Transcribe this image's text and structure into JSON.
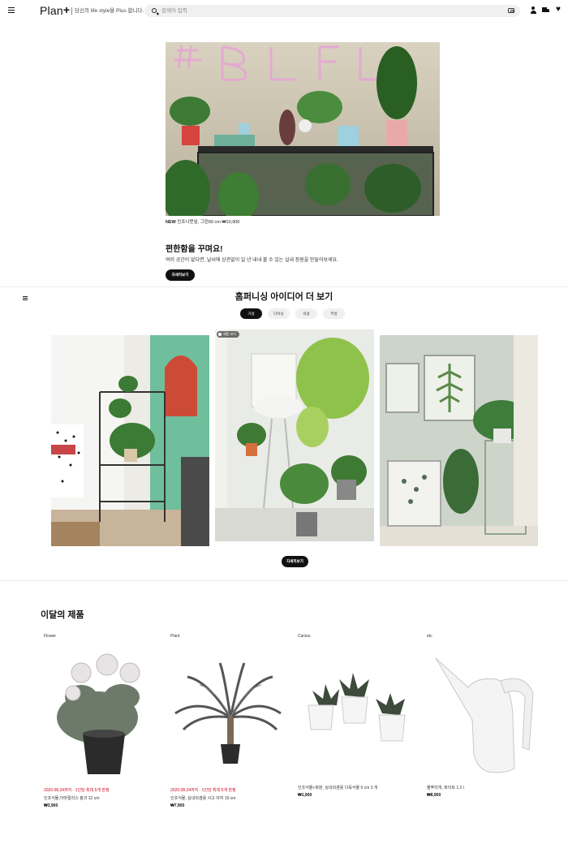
{
  "header": {
    "logo": "Plan",
    "logo_plus": "+",
    "tagline": "당신의 life style을 Plus 합니다.",
    "search_placeholder": "검색어 입력"
  },
  "hero": {
    "caption_new": "NEW",
    "caption_text": " 인조나뭇잎, 그린60 cm ₩10,900",
    "title": "편한함을 꾸며요!",
    "description": "여러 공간이 없다면, 날씨에 상관없이 일 년 내내 볼 수 있는 실내 정원을 만들어보세요.",
    "button": "자세히보기"
  },
  "ideas": {
    "title": "홈퍼니싱 아이디어 더 보기",
    "tabs": [
      "거실",
      "다이닝",
      "욕실",
      "주방"
    ],
    "badge": "제품 보기",
    "button": "자세히보기"
  },
  "products": {
    "title": "이달의 제품",
    "items": [
      {
        "category": "Flower",
        "promo": "2020.08.24까지 · 1인당 최대 5개 한정",
        "name": "인조식물,아마릴리스 핑크 12 cm",
        "price": "₩3,900"
      },
      {
        "category": "Plant",
        "promo": "2020.08.24까지 · 1인당 최대 5개 한정",
        "name": "인조식물, 실내외겸용 사고 야자 19 cm",
        "price": "₩7,900"
      },
      {
        "category": "Cactus",
        "promo": "",
        "name": "인조식물+화분, 실내외겸용 다육식물 6 cm 3 개",
        "price": "₩1,900"
      },
      {
        "category": "etc",
        "promo": "",
        "name": "물뿌리개, 화이트 1.2 l",
        "price": "₩8,900"
      }
    ]
  },
  "colors": {
    "accent_black": "#111111",
    "promo_red": "#d0021b",
    "tab_bg": "#f0f0f0"
  }
}
